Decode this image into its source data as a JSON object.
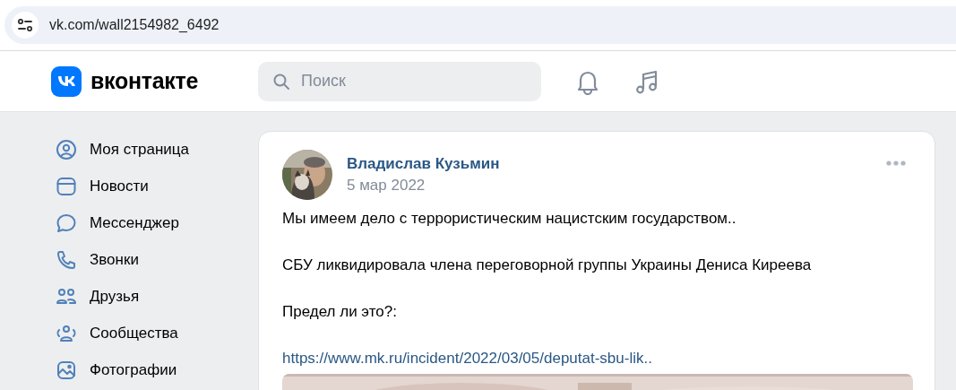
{
  "address_bar": {
    "url": "vk.com/wall2154982_6492"
  },
  "header": {
    "logo_text": "вконтакте",
    "search": {
      "placeholder": "Поиск"
    }
  },
  "sidebar": {
    "items": [
      {
        "label": "Моя страница"
      },
      {
        "label": "Новости"
      },
      {
        "label": "Мессенджер"
      },
      {
        "label": "Звонки"
      },
      {
        "label": "Друзья"
      },
      {
        "label": "Сообщества"
      },
      {
        "label": "Фотографии"
      }
    ]
  },
  "post": {
    "author": "Владислав Кузьмин",
    "date": "5 мар 2022",
    "paragraphs": [
      {
        "kind": "text",
        "text": "Мы имеем дело с террористическим нацистским государством.."
      },
      {
        "kind": "text",
        "text": "СБУ ликвидировала члена переговорной группы Украины Дениса Киреева"
      },
      {
        "kind": "text",
        "text": "Предел ли это?:"
      },
      {
        "kind": "link",
        "text": "https://www.mk.ru/incident/2022/03/05/deputat-sbu-lik.."
      }
    ]
  }
}
